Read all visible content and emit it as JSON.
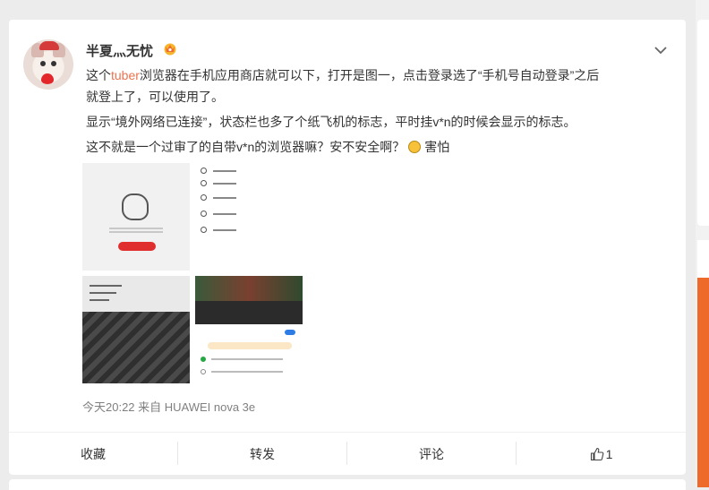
{
  "post": {
    "username": "半夏灬无忧",
    "lines": {
      "l1_pre": "这个",
      "l1_link": "tuber",
      "l1_post": "浏览器在手机应用商店就可以下，打开是图一，点击登录选了“手机号自动登录”之后",
      "l2": "就登上了，可以使用了。",
      "l3": "显示“境外网络已连接”，状态栏也多了个纸飞机的标志，平时挂v*n的时候会显示的标志。",
      "l4_pre": "这不就是一个过审了的自带v*n的浏览器嘛？安不安全啊？",
      "l4_post": "害怕"
    },
    "meta": "今天20:22  来自 HUAWEI nova 3e"
  },
  "actions": {
    "favorite": "收藏",
    "repost": "转发",
    "comment": "评论",
    "like_count": "1"
  },
  "colors": {
    "link": "#eb7350",
    "accent_orange": "#ee6a2a"
  },
  "icons": {
    "crown": "crown-icon",
    "chevron": "chevron-down-icon",
    "emoji": "scared-emoji-icon",
    "like": "thumbs-up-icon"
  }
}
